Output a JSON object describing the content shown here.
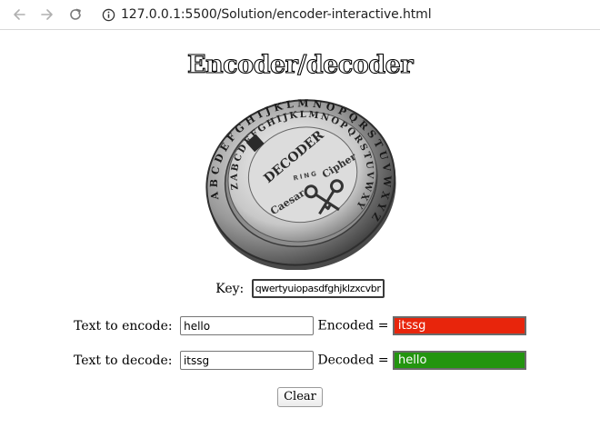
{
  "browser": {
    "url": "127.0.0.1:5500/Solution/encoder-interactive.html",
    "icons": [
      "back-arrow-icon",
      "forward-arrow-icon",
      "reload-icon",
      "info-icon"
    ]
  },
  "page": {
    "title": "Encoder/decoder",
    "coin_image": {
      "outer_ring": "ABCDEFGHIJKLMNOPQRSTUVWXYZ",
      "inner_ring": "ZABCDEFGHIJKLMNOPQRSTUVWXY",
      "center_text": [
        "DECODER",
        "RING",
        "Caesar",
        "Cipher"
      ]
    },
    "key": {
      "label": "Key:",
      "value": "qwertyuiopasdfghjklzxcvbnm"
    },
    "encode": {
      "label": "Text to encode:",
      "value": "hello",
      "result_label": "Encoded =",
      "result": "itssg",
      "result_color": "#e8250c"
    },
    "decode": {
      "label": "Text to decode:",
      "value": "itssg",
      "result_label": "Decoded =",
      "result": "hello",
      "result_color": "#23950f"
    },
    "clear_label": "Clear"
  }
}
